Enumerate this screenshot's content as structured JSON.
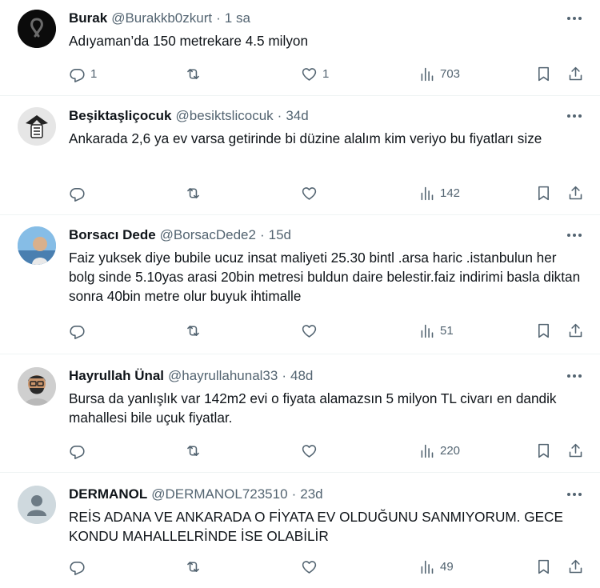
{
  "tweets": [
    {
      "name": "Burak",
      "handle": "@Burakkb0zkurt",
      "dot": "·",
      "time": "1 sa",
      "text": "Adıyaman’da 150 metrekare 4.5 milyon",
      "replies": "1",
      "retweets": "",
      "likes": "1",
      "views": "703"
    },
    {
      "name": "Beşiktaşliçocuk",
      "handle": "@besiktslicocuk",
      "dot": "·",
      "time": "34d",
      "text": "Ankarada 2,6 ya ev varsa getirinde bi düzine alalım kim veriyo bu fiyatları size",
      "replies": "",
      "retweets": "",
      "likes": "",
      "views": "142"
    },
    {
      "name": "Borsacı Dede",
      "handle": "@BorsacDede2",
      "dot": "·",
      "time": "15d",
      "text": "Faiz yuksek diye bubile ucuz insat maliyeti 25.30 bintl .arsa haric .istanbulun her bolg sinde 5.10yas arasi 20bin metresi buldun daire belestir.faiz indirimi basla diktan sonra 40bin metre olur buyuk ihtimalle",
      "replies": "",
      "retweets": "",
      "likes": "",
      "views": "51"
    },
    {
      "name": "Hayrullah Ünal",
      "handle": "@hayrullahunal33",
      "dot": "·",
      "time": "48d",
      "text": "Bursa da yanlışlık var 142m2 evi o fiyata alamazsın 5 milyon TL civarı en dandik mahallesi bile uçuk fiyatlar.",
      "replies": "",
      "retweets": "",
      "likes": "",
      "views": "220"
    },
    {
      "name": "DERMANOL",
      "handle": "@DERMANOL723510",
      "dot": "·",
      "time": "23d",
      "text": "REİS ADANA VE ANKARADA O FİYATA EV OLDUĞUNU SANMIYORUM. GECE KONDU MAHALLELRİNDE İSE OLABİLİR",
      "replies": "",
      "retweets": "",
      "likes": "",
      "views": "49"
    }
  ]
}
